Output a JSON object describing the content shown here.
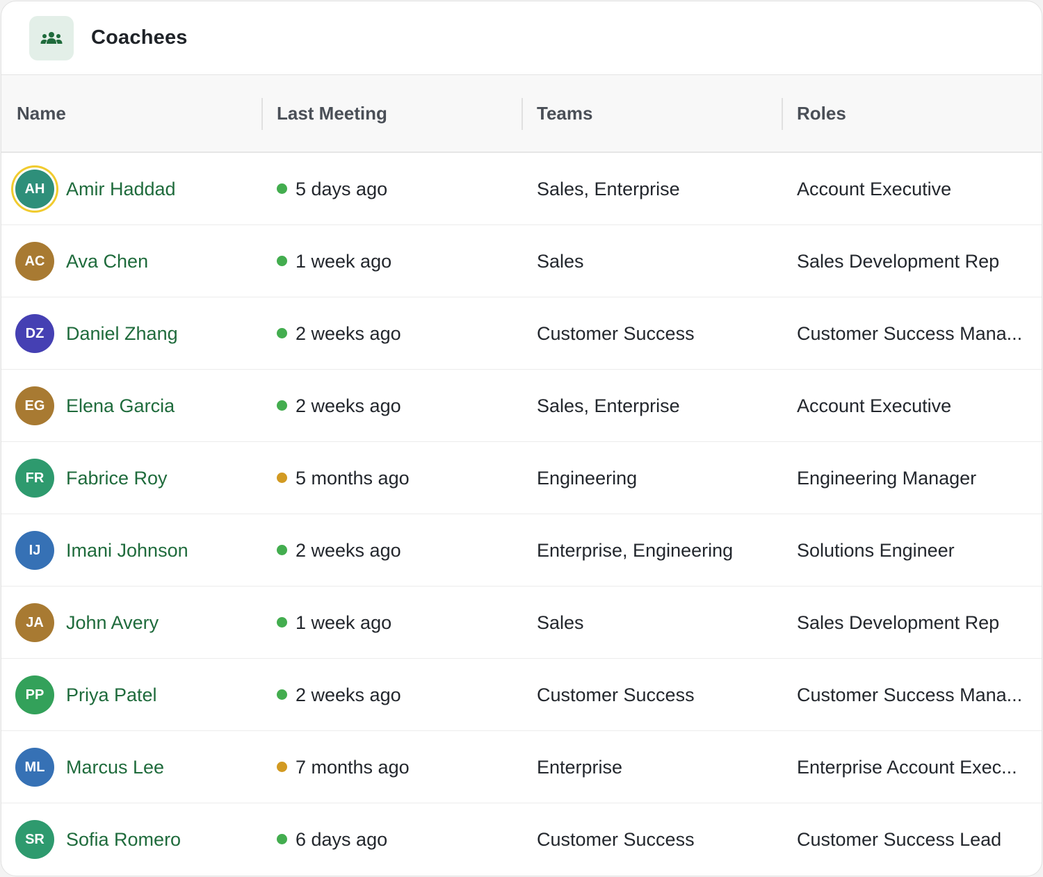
{
  "header": {
    "title": "Coachees",
    "icon": "people-group-icon"
  },
  "columns": [
    "Name",
    "Last Meeting",
    "Teams",
    "Roles"
  ],
  "colors": {
    "name_link": "#1f6b3c",
    "status_recent": "#43ad4f",
    "status_stale": "#d29a22",
    "header_icon_bg": "#e3efe8",
    "highlight_ring": "#f1cb2e"
  },
  "rows": [
    {
      "initials": "AH",
      "name": "Amir Haddad",
      "last_meeting": "5 days ago",
      "status": "recent",
      "teams": "Sales, Enterprise",
      "roles": "Account Executive",
      "avatar_color": "#2e8f7a",
      "highlighted": true
    },
    {
      "initials": "AC",
      "name": "Ava Chen",
      "last_meeting": "1 week ago",
      "status": "recent",
      "teams": "Sales",
      "roles": "Sales Development Rep",
      "avatar_color": "#a87a32",
      "highlighted": false
    },
    {
      "initials": "DZ",
      "name": "Daniel Zhang",
      "last_meeting": "2 weeks ago",
      "status": "recent",
      "teams": "Customer Success",
      "roles": "Customer Success Mana...",
      "avatar_color": "#4540b3",
      "highlighted": false
    },
    {
      "initials": "EG",
      "name": "Elena Garcia",
      "last_meeting": "2 weeks ago",
      "status": "recent",
      "teams": "Sales, Enterprise",
      "roles": "Account Executive",
      "avatar_color": "#a87a32",
      "highlighted": false
    },
    {
      "initials": "FR",
      "name": "Fabrice Roy",
      "last_meeting": "5 months ago",
      "status": "stale",
      "teams": "Engineering",
      "roles": "Engineering Manager",
      "avatar_color": "#2e9a6e",
      "highlighted": false
    },
    {
      "initials": "IJ",
      "name": "Imani Johnson",
      "last_meeting": "2 weeks ago",
      "status": "recent",
      "teams": "Enterprise, Engineering",
      "roles": "Solutions Engineer",
      "avatar_color": "#3671b5",
      "highlighted": false
    },
    {
      "initials": "JA",
      "name": "John Avery",
      "last_meeting": "1 week ago",
      "status": "recent",
      "teams": "Sales",
      "roles": "Sales Development Rep",
      "avatar_color": "#a87a32",
      "highlighted": false
    },
    {
      "initials": "PP",
      "name": "Priya Patel",
      "last_meeting": "2 weeks ago",
      "status": "recent",
      "teams": "Customer Success",
      "roles": "Customer Success Mana...",
      "avatar_color": "#33a15a",
      "highlighted": false
    },
    {
      "initials": "ML",
      "name": "Marcus Lee",
      "last_meeting": "7 months ago",
      "status": "stale",
      "teams": "Enterprise",
      "roles": "Enterprise Account Exec...",
      "avatar_color": "#3671b5",
      "highlighted": false
    },
    {
      "initials": "SR",
      "name": "Sofia Romero",
      "last_meeting": "6 days ago",
      "status": "recent",
      "teams": "Customer Success",
      "roles": "Customer Success Lead",
      "avatar_color": "#2e9a6e",
      "highlighted": false
    }
  ]
}
